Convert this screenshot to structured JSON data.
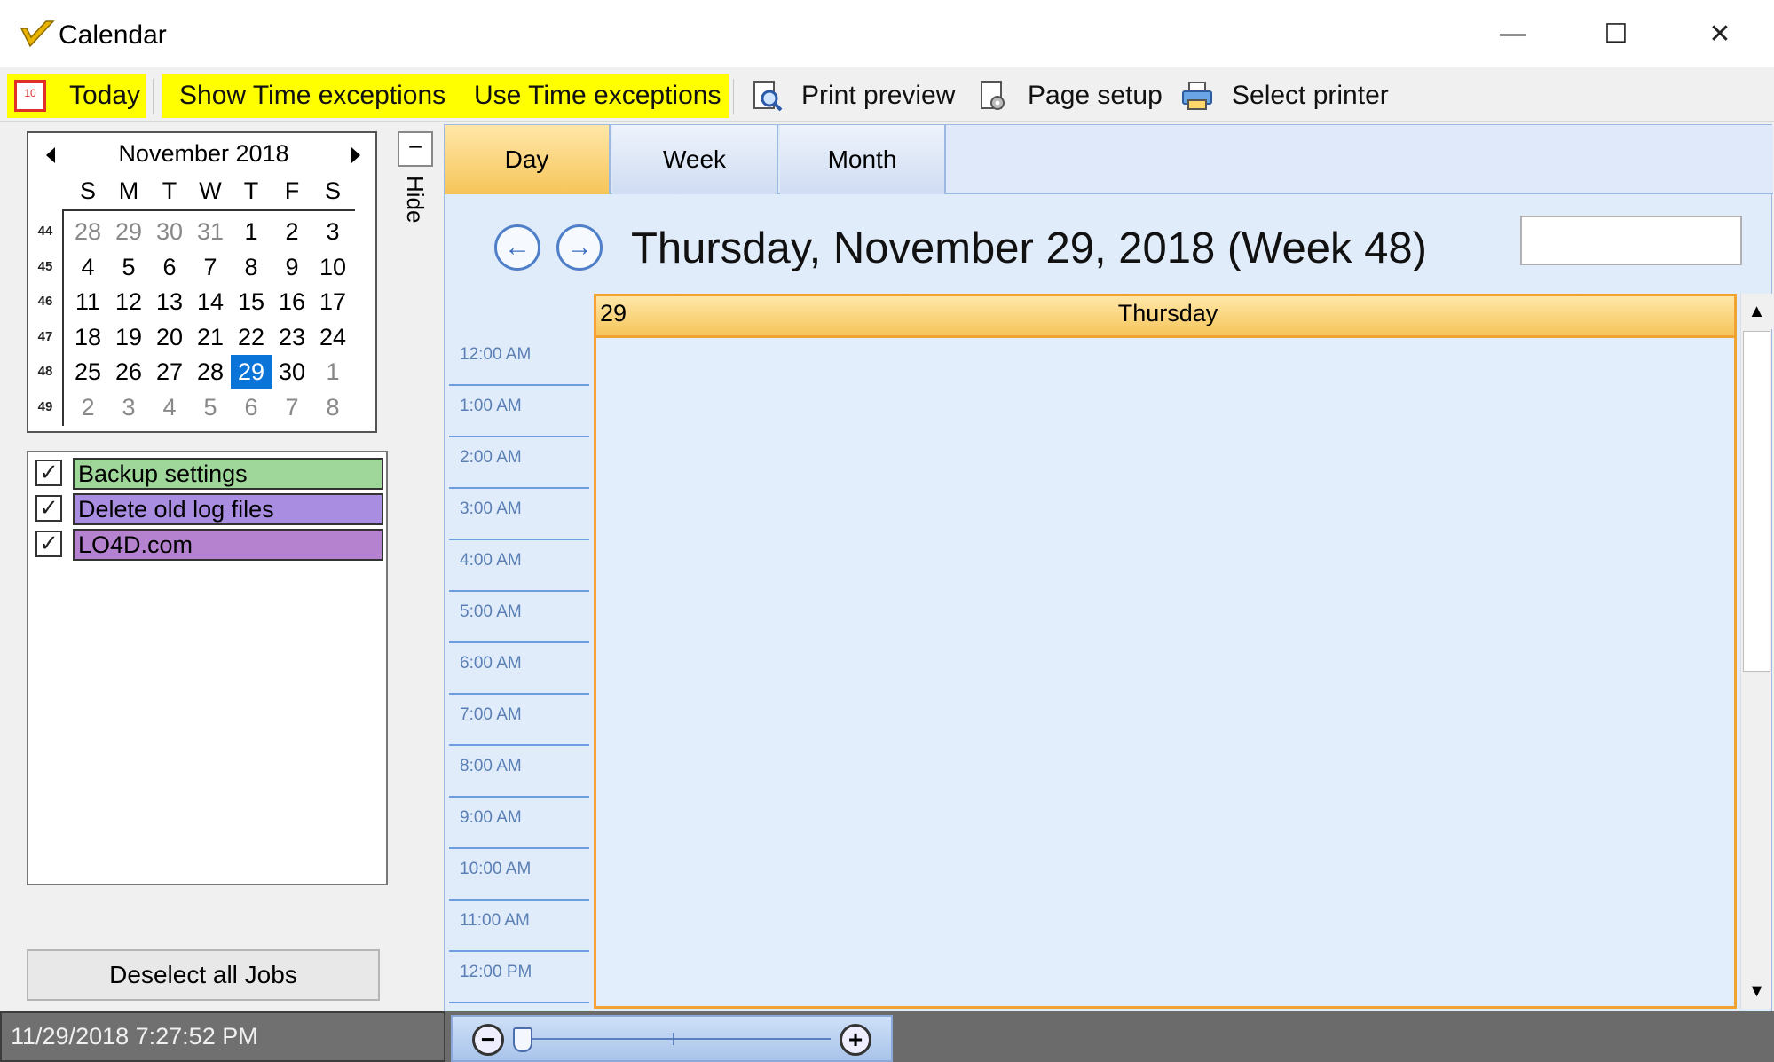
{
  "window": {
    "title": "Calendar",
    "min_glyph": "—",
    "max_glyph": "☐",
    "close_glyph": "✕"
  },
  "toolbar": {
    "today": "Today",
    "show_time_exceptions": "Show Time exceptions",
    "use_time_exceptions": "Use Time exceptions",
    "print_preview": "Print preview",
    "page_setup": "Page setup",
    "select_printer": "Select printer",
    "highlight_color": "#ffff00"
  },
  "mini_calendar": {
    "title": "November 2018",
    "days_of_week": [
      "S",
      "M",
      "T",
      "W",
      "T",
      "F",
      "S"
    ],
    "weeks": [
      {
        "num": "44",
        "days": [
          [
            "28",
            true
          ],
          [
            "29",
            true
          ],
          [
            "30",
            true
          ],
          [
            "31",
            true
          ],
          [
            "1",
            false
          ],
          [
            "2",
            false
          ],
          [
            "3",
            false
          ]
        ]
      },
      {
        "num": "45",
        "days": [
          [
            "4",
            false
          ],
          [
            "5",
            false
          ],
          [
            "6",
            false
          ],
          [
            "7",
            false
          ],
          [
            "8",
            false
          ],
          [
            "9",
            false
          ],
          [
            "10",
            false
          ]
        ]
      },
      {
        "num": "46",
        "days": [
          [
            "11",
            false
          ],
          [
            "12",
            false
          ],
          [
            "13",
            false
          ],
          [
            "14",
            false
          ],
          [
            "15",
            false
          ],
          [
            "16",
            false
          ],
          [
            "17",
            false
          ]
        ]
      },
      {
        "num": "47",
        "days": [
          [
            "18",
            false
          ],
          [
            "19",
            false
          ],
          [
            "20",
            false
          ],
          [
            "21",
            false
          ],
          [
            "22",
            false
          ],
          [
            "23",
            false
          ],
          [
            "24",
            false
          ]
        ]
      },
      {
        "num": "48",
        "days": [
          [
            "25",
            false
          ],
          [
            "26",
            false
          ],
          [
            "27",
            false
          ],
          [
            "28",
            false
          ],
          [
            "29",
            false
          ],
          [
            "30",
            false
          ],
          [
            "1",
            true
          ]
        ]
      },
      {
        "num": "49",
        "days": [
          [
            "2",
            true
          ],
          [
            "3",
            true
          ],
          [
            "4",
            true
          ],
          [
            "5",
            true
          ],
          [
            "6",
            true
          ],
          [
            "7",
            true
          ],
          [
            "8",
            true
          ]
        ]
      }
    ],
    "selected_day": "29"
  },
  "jobs": [
    {
      "label": "Backup settings",
      "checked": true,
      "color": "#9fd79a"
    },
    {
      "label": "Delete old log files",
      "checked": true,
      "color": "#a98de0"
    },
    {
      "label": "LO4D.com",
      "checked": true,
      "color": "#b482cf"
    }
  ],
  "deselect_all_label": "Deselect all Jobs",
  "hide_label": "Hide",
  "hide_glyph": "−",
  "scheduler": {
    "tabs": [
      "Day",
      "Week",
      "Month"
    ],
    "active_tab": "Day",
    "date_title": "Thursday, November 29, 2018 (Week 48)",
    "day_header_num": "29",
    "day_header_name": "Thursday",
    "time_slots": [
      "12:00 AM",
      "1:00 AM",
      "2:00 AM",
      "3:00 AM",
      "4:00 AM",
      "5:00 AM",
      "6:00 AM",
      "7:00 AM",
      "8:00 AM",
      "9:00 AM",
      "10:00 AM",
      "11:00 AM",
      "12:00 PM"
    ],
    "accent_color": "#f0a330"
  },
  "status": {
    "datetime": "11/29/2018 7:27:52 PM"
  }
}
